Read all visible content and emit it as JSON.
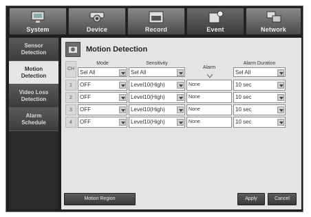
{
  "tabs": [
    {
      "label": "System",
      "icon": "monitor-icon"
    },
    {
      "label": "Device",
      "icon": "camera-icon"
    },
    {
      "label": "Record",
      "icon": "record-icon"
    },
    {
      "label": "Event",
      "icon": "event-icon"
    },
    {
      "label": "Network",
      "icon": "network-icon"
    }
  ],
  "active_tab": "Event",
  "sidebar": {
    "items": [
      {
        "label": "Sensor\nDetection"
      },
      {
        "label": "Motion\nDetection"
      },
      {
        "label": "Video Loss\nDetection"
      },
      {
        "label": "Alarm\nSchedule"
      }
    ],
    "active": "Motion Detection"
  },
  "panel": {
    "title": "Motion Detection",
    "icon": "motion-detection-icon"
  },
  "table": {
    "headers": {
      "ch": "CH",
      "mode": "Mode",
      "sensitivity": "Sensitivity",
      "alarm": "Alarm",
      "alarm_duration": "Alarm Duration"
    },
    "select_all": {
      "mode": "Sel All",
      "sensitivity": "Sel All",
      "alarm_duration": "Sel All"
    },
    "rows": [
      {
        "ch": "1",
        "mode": "OFF",
        "sensitivity": "Level10(High)",
        "alarm": "None",
        "alarm_duration": "10 sec"
      },
      {
        "ch": "2",
        "mode": "OFF",
        "sensitivity": "Level10(High)",
        "alarm": "None",
        "alarm_duration": "10 sec"
      },
      {
        "ch": "3",
        "mode": "OFF",
        "sensitivity": "Level10(High)",
        "alarm": "None",
        "alarm_duration": "10 sec"
      },
      {
        "ch": "4",
        "mode": "OFF",
        "sensitivity": "Level10(High)",
        "alarm": "None",
        "alarm_duration": "10 sec"
      }
    ]
  },
  "buttons": {
    "motion_region": "Motion Region",
    "apply": "Apply",
    "cancel": "Cancel"
  }
}
